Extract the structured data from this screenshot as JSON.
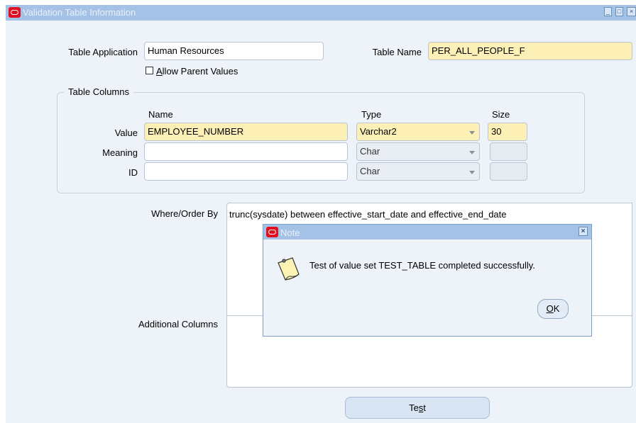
{
  "window": {
    "title": "Validation Table Information"
  },
  "form": {
    "table_application_label": "Table Application",
    "table_application_value": "Human Resources",
    "table_name_label": "Table Name",
    "table_name_value": "PER_ALL_PEOPLE_F",
    "allow_parent_label_u": "A",
    "allow_parent_label_rest": "llow Parent Values",
    "table_columns_label": "Table Columns",
    "headers": {
      "name": "Name",
      "type": "Type",
      "size": "Size"
    },
    "rows": [
      {
        "label": "Value",
        "name": "EMPLOYEE_NUMBER",
        "type": "Varchar2",
        "size": "30"
      },
      {
        "label": "Meaning",
        "name": "",
        "type": "Char",
        "size": ""
      },
      {
        "label": "ID",
        "name": "",
        "type": "Char",
        "size": ""
      }
    ],
    "where_label": "Where/Order By",
    "where_value": "trunc(sysdate) between effective_start_date and effective_end_date",
    "additional_label": "Additional Columns",
    "test_pre": "Te",
    "test_u": "s",
    "test_post": "t"
  },
  "note": {
    "title": "Note",
    "message": "Test of value set TEST_TABLE completed successfully.",
    "ok_u": "O",
    "ok_rest": "K"
  },
  "colors": {
    "titlebar": "#a4c2e5",
    "background": "#eef3f9",
    "required_field": "#fdf0b7",
    "oracle_red": "#e10f1f"
  }
}
